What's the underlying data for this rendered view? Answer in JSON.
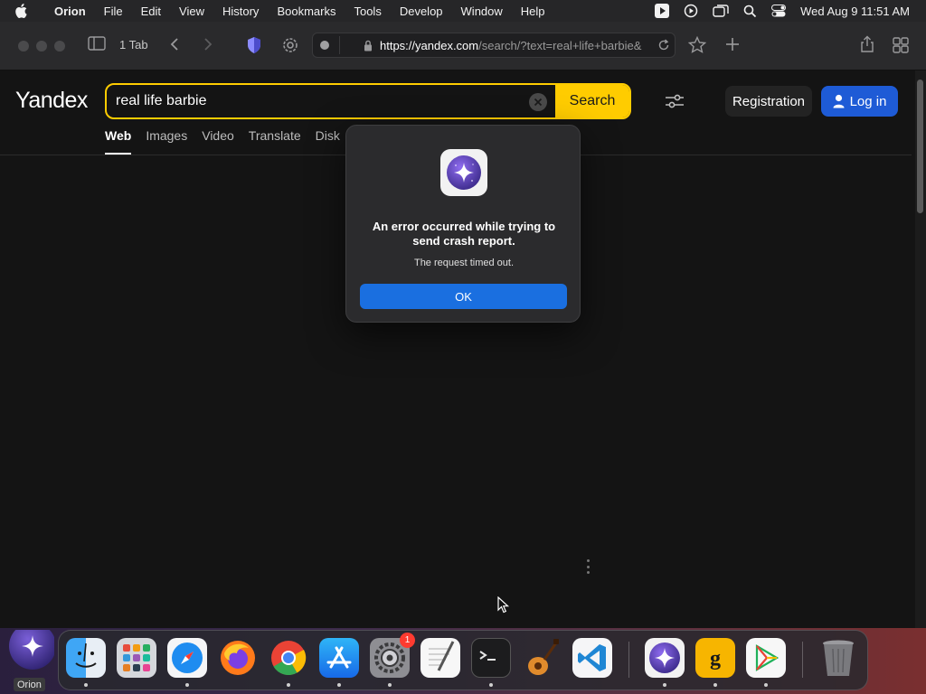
{
  "menubar": {
    "app_name": "Orion",
    "items": [
      "File",
      "Edit",
      "View",
      "History",
      "Bookmarks",
      "Tools",
      "Develop",
      "Window",
      "Help"
    ],
    "clock": "Wed Aug 9  11:51 AM"
  },
  "browser": {
    "tab_count": "1 Tab",
    "url_host": "https://yandex.com",
    "url_path": "/search/?text=real+life+barbie&"
  },
  "page": {
    "logo": "Yandex",
    "search_query": "real life barbie",
    "search_button": "Search",
    "registration_button": "Registration",
    "login_button": "Log in",
    "nav": [
      "Web",
      "Images",
      "Video",
      "Translate",
      "Disk"
    ],
    "active_nav": "Web",
    "accent_color": "#ffcc00"
  },
  "dialog": {
    "title": "An error occurred while trying to send crash report.",
    "message": "The request timed out.",
    "ok_button": "OK"
  },
  "dock": {
    "active_app_label": "Orion",
    "apps": [
      {
        "name": "Finder",
        "icon": "finder-icon"
      },
      {
        "name": "Launchpad",
        "icon": "launchpad-icon"
      },
      {
        "name": "Safari",
        "icon": "safari-icon"
      },
      {
        "name": "Firefox",
        "icon": "firefox-icon"
      },
      {
        "name": "Chrome",
        "icon": "chrome-icon"
      },
      {
        "name": "App Store",
        "icon": "app-store-icon"
      },
      {
        "name": "System Settings",
        "icon": "settings-icon",
        "badge": "1"
      },
      {
        "name": "TextEdit",
        "icon": "textedit-icon"
      },
      {
        "name": "Terminal",
        "icon": "terminal-icon"
      },
      {
        "name": "GarageBand",
        "icon": "guitar-icon"
      },
      {
        "name": "VS Code",
        "icon": "vscode-icon"
      },
      {
        "name": "Orion",
        "icon": "orion-icon"
      },
      {
        "name": "Grammarly",
        "icon": "grammarly-icon"
      },
      {
        "name": "Play",
        "icon": "play-store-icon"
      },
      {
        "name": "Trash",
        "icon": "trash-icon"
      }
    ]
  }
}
